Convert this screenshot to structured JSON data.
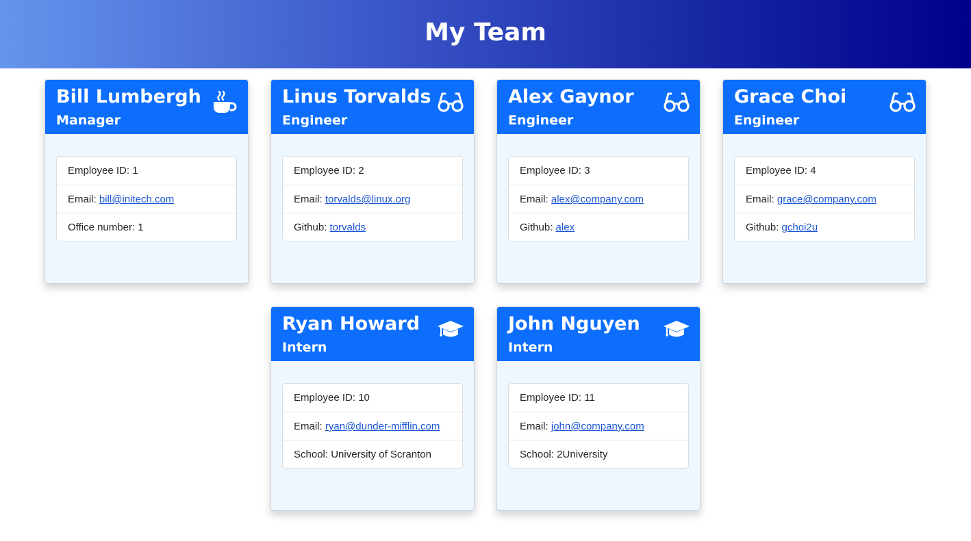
{
  "page": {
    "title": "My Team"
  },
  "cards": [
    {
      "name": "Bill Lumbergh",
      "role": "Manager",
      "icon": "coffee-icon",
      "id_label": "Employee ID:",
      "id_value": "1",
      "email_label": "Email:",
      "email": "bill@initech.com",
      "extra_label": "Office number:",
      "extra_value": "1"
    },
    {
      "name": "Linus Torvalds",
      "role": "Engineer",
      "icon": "glasses-icon",
      "id_label": "Employee ID:",
      "id_value": "2",
      "email_label": "Email:",
      "email": "torvalds@linux.org",
      "extra_label": "Github:",
      "extra_value": "torvalds"
    },
    {
      "name": "Alex Gaynor",
      "role": "Engineer",
      "icon": "glasses-icon",
      "id_label": "Employee ID:",
      "id_value": "3",
      "email_label": "Email:",
      "email": "alex@company.com",
      "extra_label": "Github:",
      "extra_value": "alex"
    },
    {
      "name": "Grace Choi",
      "role": "Engineer",
      "icon": "glasses-icon",
      "id_label": "Employee ID:",
      "id_value": "4",
      "email_label": "Email:",
      "email": "grace@company.com",
      "extra_label": "Github:",
      "extra_value": "gchoi2u"
    },
    {
      "name": "Ryan Howard",
      "role": "Intern",
      "icon": "graduation-cap-icon",
      "id_label": "Employee ID:",
      "id_value": "10",
      "email_label": "Email:",
      "email": "ryan@dunder-mifflin.com",
      "extra_label": "School:",
      "extra_value": "University of Scranton"
    },
    {
      "name": "John Nguyen",
      "role": "Intern",
      "icon": "graduation-cap-icon",
      "id_label": "Employee ID:",
      "id_value": "11",
      "email_label": "Email:",
      "email": "john@company.com",
      "extra_label": "School:",
      "extra_value": "2University"
    }
  ],
  "colors": {
    "header_gradient_start": "#6495ed",
    "header_gradient_end": "#00008b",
    "card_header": "#0d6efd",
    "card_body": "#eef6fe",
    "link": "#1a55d6"
  }
}
